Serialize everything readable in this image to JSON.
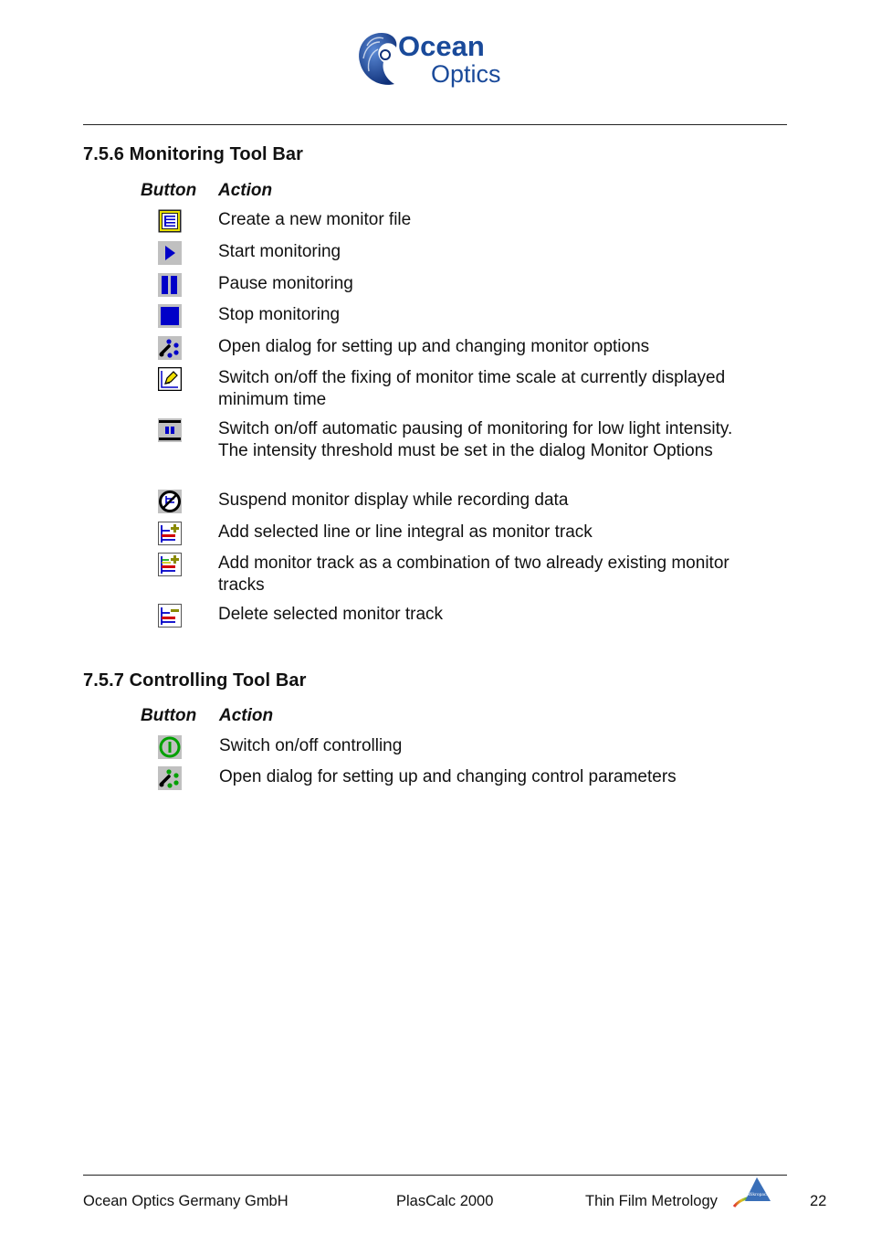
{
  "header": {
    "logo_line1": "Ocean",
    "logo_line2": "Optics"
  },
  "sections": [
    {
      "title": "7.5.6 Monitoring Tool Bar",
      "col_button": "Button",
      "col_action": "Action",
      "rows": [
        {
          "icon": "new-monitor-file-icon",
          "action": "Create a new monitor file"
        },
        {
          "icon": "play-icon",
          "action": "Start monitoring"
        },
        {
          "icon": "pause-icon",
          "action": "Pause monitoring"
        },
        {
          "icon": "stop-icon",
          "action": "Stop monitoring"
        },
        {
          "icon": "monitor-options-icon",
          "action": "Open dialog for setting up and changing monitor options"
        },
        {
          "icon": "fix-time-scale-icon",
          "action": "Switch on/off the fixing of monitor time scale at currently displayed minimum time"
        },
        {
          "icon": "auto-pause-icon",
          "action": "Switch on/off automatic pausing of monitoring for low light intensity. The intensity threshold must be set in the dialog Monitor Options"
        },
        {
          "icon": "suspend-display-icon",
          "action": "Suspend monitor display while recording data"
        },
        {
          "icon": "add-track-icon",
          "action": "Add selected line or line integral as monitor track"
        },
        {
          "icon": "add-combined-track-icon",
          "action": "Add monitor track as a combination of two already existing monitor tracks"
        },
        {
          "icon": "delete-track-icon",
          "action": "Delete selected monitor track"
        }
      ]
    },
    {
      "title": "7.5.7 Controlling Tool Bar",
      "col_button": "Button",
      "col_action": "Action",
      "rows": [
        {
          "icon": "power-icon",
          "action": "Switch on/off controlling"
        },
        {
          "icon": "control-parameters-icon",
          "action": "Open dialog for setting up and changing control parameters"
        }
      ]
    }
  ],
  "footer": {
    "company": "Ocean Optics Germany GmbH",
    "product": "PlasCalc 2000",
    "division": "Thin Film Metrology",
    "division_logo_text": "Mikropack",
    "page_number": "22"
  },
  "colors": {
    "toolbar_gray": "#c0c0c0",
    "icon_blue": "#0000c8",
    "icon_green": "#00a000",
    "logo_blue": "#1a4a9a"
  }
}
